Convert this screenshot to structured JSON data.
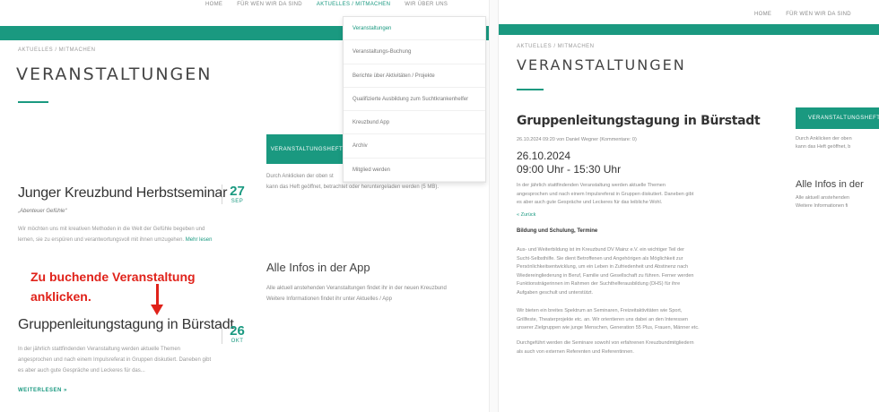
{
  "left": {
    "nav": [
      "HOME",
      "FÜR WEN WIR DA SIND",
      "AKTUELLES / MITMACHEN",
      "WIR ÜBER UNS"
    ],
    "active_nav_index": 2,
    "breadcrumb": "AKTUELLES / MITMACHEN",
    "page_title": "VERANSTALTUNGEN",
    "dropdown": [
      "Veranstaltungen",
      "Veranstaltungs-Buchung",
      "Berichte über Aktivitäten / Projekte",
      "Qualifizierte Ausbildung zum Suchtkrankenhelfer",
      "Kreuzbund App",
      "Archiv",
      "Mitglied werden"
    ],
    "events": [
      {
        "title": "Junger Kreuzbund Herbstseminar",
        "subtitle": "„Abenteuer Gefühle“",
        "text_1": "Wir möchten uns mit kreativen Methoden in die Welt der Gefühle begeben und",
        "text_2": "lernen, sie zu erspüren und verantwortungsvoll mit ihnen umzugehen.",
        "link": "Mehr lesen",
        "day": "27",
        "month": "SEP"
      },
      {
        "title": "Gruppenleitungstagung in Bürstadt",
        "text_1": "In der jährlich stattfindenden Veranstaltung werden aktuelle Themen",
        "text_2": "angesprochen und nach einem Impulsreferat in Gruppen diskutiert. Daneben gibt",
        "text_3": "es aber auch gute Gespräche und Leckeres für das...",
        "more": "WEITERLESEN »",
        "day": "26",
        "month": "OKT"
      }
    ],
    "annotation_line1": "Zu buchende Veranstaltung",
    "annotation_line2": "anklicken.",
    "sidebar": {
      "button": "VERANSTALTUNGSHEFT",
      "button_text_1": "Durch Anklicken der oben st",
      "button_text_2": "kann das Heft geöffnet, betrachtet oder heruntergeladen werden (5 MB).",
      "app_heading": "Alle Infos in der App",
      "app_text_1": "Alle aktuell anstehenden Veranstaltungen findet ihr in der neuen Kreuzbund",
      "app_text_2": "Weitere Informationen findet ihr unter Aktuelles / App"
    }
  },
  "right": {
    "nav": [
      "HOME",
      "FÜR WEN WIR DA SIND"
    ],
    "breadcrumb": "AKTUELLES / MITMACHEN",
    "page_title": "VERANSTALTUNGEN",
    "event_title": "Gruppenleitungstagung in Bürstadt",
    "meta": "26.10.2024 09:20 von Daniel Wegner (Kommentare: 0)",
    "date": "26.10.2024",
    "time": "09:00 Uhr - 15:30 Uhr",
    "intro_1": "In der jährlich stattfindenden Veranstaltung werden aktuelle Themen",
    "intro_2": "angesprochen und nach einem Impulsreferat in Gruppen diskutiert. Daneben gibt",
    "intro_3": "es aber auch gute Gespräche und Leckeres für das leibliche Wohl.",
    "back": "« Zurück",
    "section": "Bildung und Schulung, Termine",
    "p1_1": "Aus- und Weiterbildung ist im Kreuzbund DV Mainz e.V. ein wichtiger Teil der",
    "p1_2": "Sucht-Selbsthilfe. Sie dient Betroffenen und Angehörigen als Möglichkeit zur",
    "p1_3": "Persönlichkeitsentwicklung, um ein Leben in Zufriedenheit und Abstinenz nach",
    "p1_4": "Wiedereingliederung in Beruf, Familie und Gesellschaft zu führen. Ferner werden",
    "p1_5": "Funktionsträgerinnen im Rahmen der Suchthelferausbildung (DHS) für ihre",
    "p1_6": "Aufgaben geschult und unterstützt.",
    "p2_1": "Wir bieten ein breites Spektrum an Seminaren, Freizeitaktivitäten wie Sport,",
    "p2_2": "Grillfeste, Theaterprojekte etc. an. Wir orientieren uns dabei an den Interessen",
    "p2_3": "unserer Zielgruppen wie junge Menschen, Generation 55 Plus, Frauen, Männer etc.",
    "p3_1": "Durchgeführt werden die Seminare sowohl von erfahrenen Kreuzbundmitgliedern",
    "p3_2": "als auch von externen Referenten und Referentinnen.",
    "side_button": "VERANSTALTUNGSHEFT",
    "side_text_1": "Durch Anklicken der oben",
    "side_text_2": "kann das Heft geöffnet, b",
    "side_heading": "Alle Infos in der",
    "side_app_1": "Alle aktuell anstehenden",
    "side_app_2": "Weitere Informationen fi"
  },
  "colors": {
    "accent": "#1a9980",
    "annotation": "#e0221a"
  }
}
